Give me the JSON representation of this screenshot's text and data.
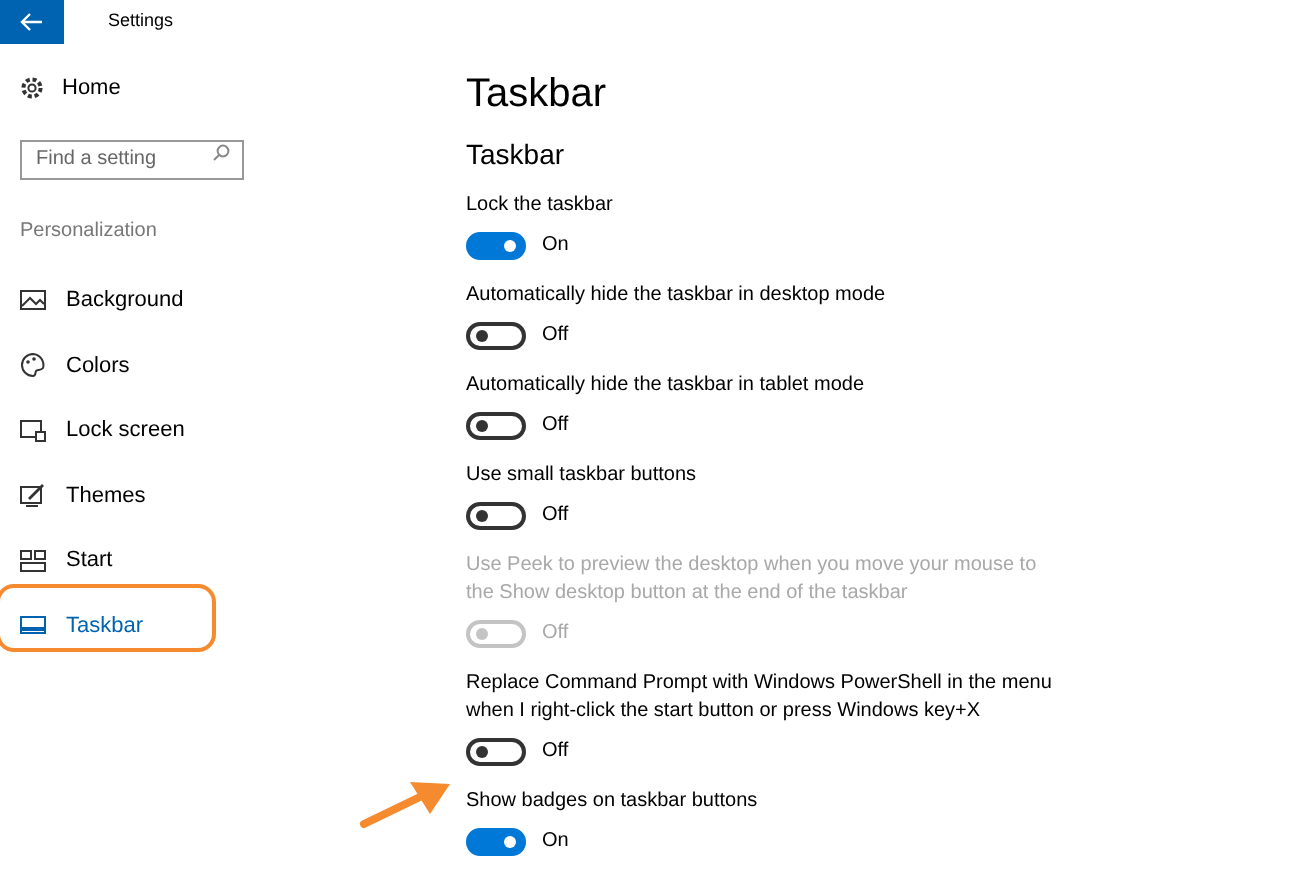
{
  "window": {
    "title": "Settings"
  },
  "sidebar": {
    "home": "Home",
    "search": {
      "placeholder": "Find a setting"
    },
    "section": "Personalization",
    "items": [
      {
        "label": "Background",
        "selected": false
      },
      {
        "label": "Colors",
        "selected": false
      },
      {
        "label": "Lock screen",
        "selected": false
      },
      {
        "label": "Themes",
        "selected": false
      },
      {
        "label": "Start",
        "selected": false
      },
      {
        "label": "Taskbar",
        "selected": true
      }
    ]
  },
  "page": {
    "title": "Taskbar",
    "heading": "Taskbar",
    "settings": [
      {
        "label": "Lock the taskbar",
        "on": true,
        "disabled": false,
        "state": "On"
      },
      {
        "label": "Automatically hide the taskbar in desktop mode",
        "on": false,
        "disabled": false,
        "state": "Off"
      },
      {
        "label": "Automatically hide the taskbar in tablet mode",
        "on": false,
        "disabled": false,
        "state": "Off"
      },
      {
        "label": "Use small taskbar buttons",
        "on": false,
        "disabled": false,
        "state": "Off"
      },
      {
        "label": "Use Peek to preview the desktop when you move your mouse to the Show desktop button at the end of the taskbar",
        "on": false,
        "disabled": true,
        "state": "Off"
      },
      {
        "label": "Replace Command Prompt with Windows PowerShell in the menu when I right-click the start button or press Windows key+X",
        "on": false,
        "disabled": false,
        "state": "Off"
      },
      {
        "label": "Show badges on taskbar buttons",
        "on": true,
        "disabled": false,
        "state": "On"
      }
    ]
  }
}
